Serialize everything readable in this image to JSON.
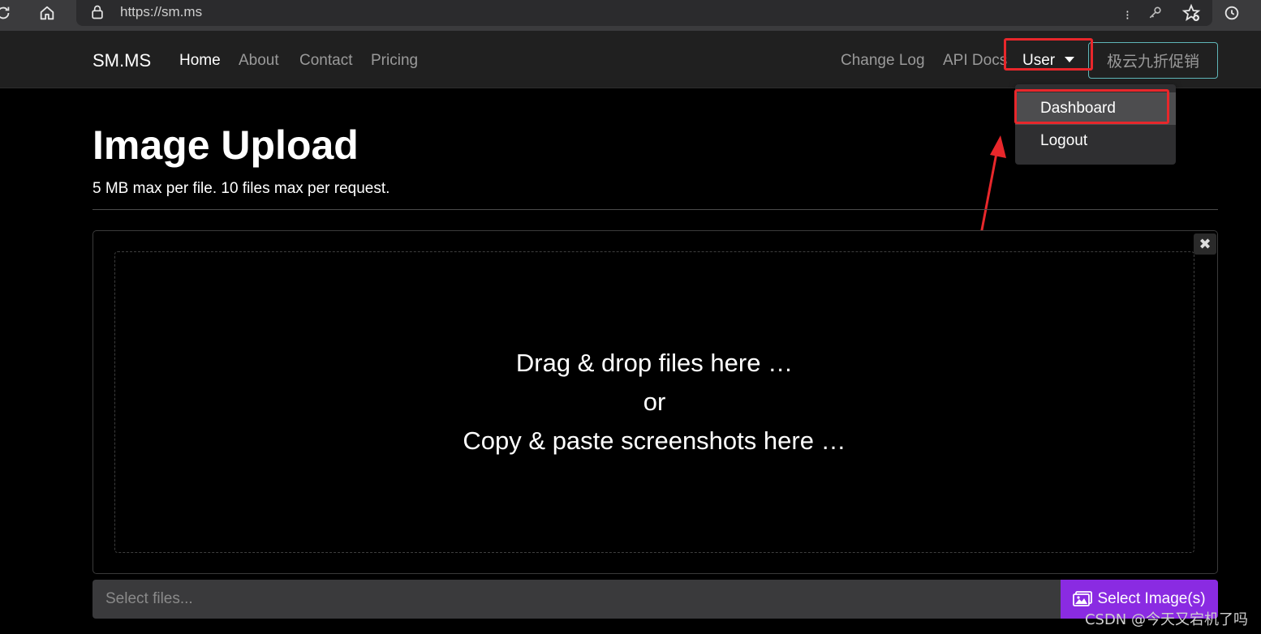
{
  "browser": {
    "url": "https://sm.ms",
    "icons": [
      "reload-icon",
      "home-icon",
      "lock-icon",
      "reader-icon",
      "key-icon",
      "favorites-add-icon",
      "history-icon"
    ]
  },
  "nav": {
    "brand": "SM.MS",
    "links": [
      "Home",
      "About",
      "Contact",
      "Pricing"
    ],
    "right_links": [
      "Change Log",
      "API Docs"
    ],
    "user_label": "User",
    "promo_label": "极云九折促销"
  },
  "dropdown": {
    "items": [
      "Dashboard",
      "Logout"
    ],
    "highlighted": "Dashboard"
  },
  "page": {
    "title": "Image Upload",
    "subtitle": "5 MB max per file. 10 files max per request."
  },
  "dropzone": {
    "line1": "Drag & drop files here …",
    "line2": "or",
    "line3": "Copy & paste screenshots here …",
    "close_symbol": "✖"
  },
  "file_input": {
    "placeholder": "Select files...",
    "button_label": "Select Image(s)"
  },
  "watermark": "CSDN @今天又宕机了吗",
  "colors": {
    "accent": "#8a2be2",
    "annotation": "#e8272b",
    "promo_border": "#5fb6b8"
  }
}
